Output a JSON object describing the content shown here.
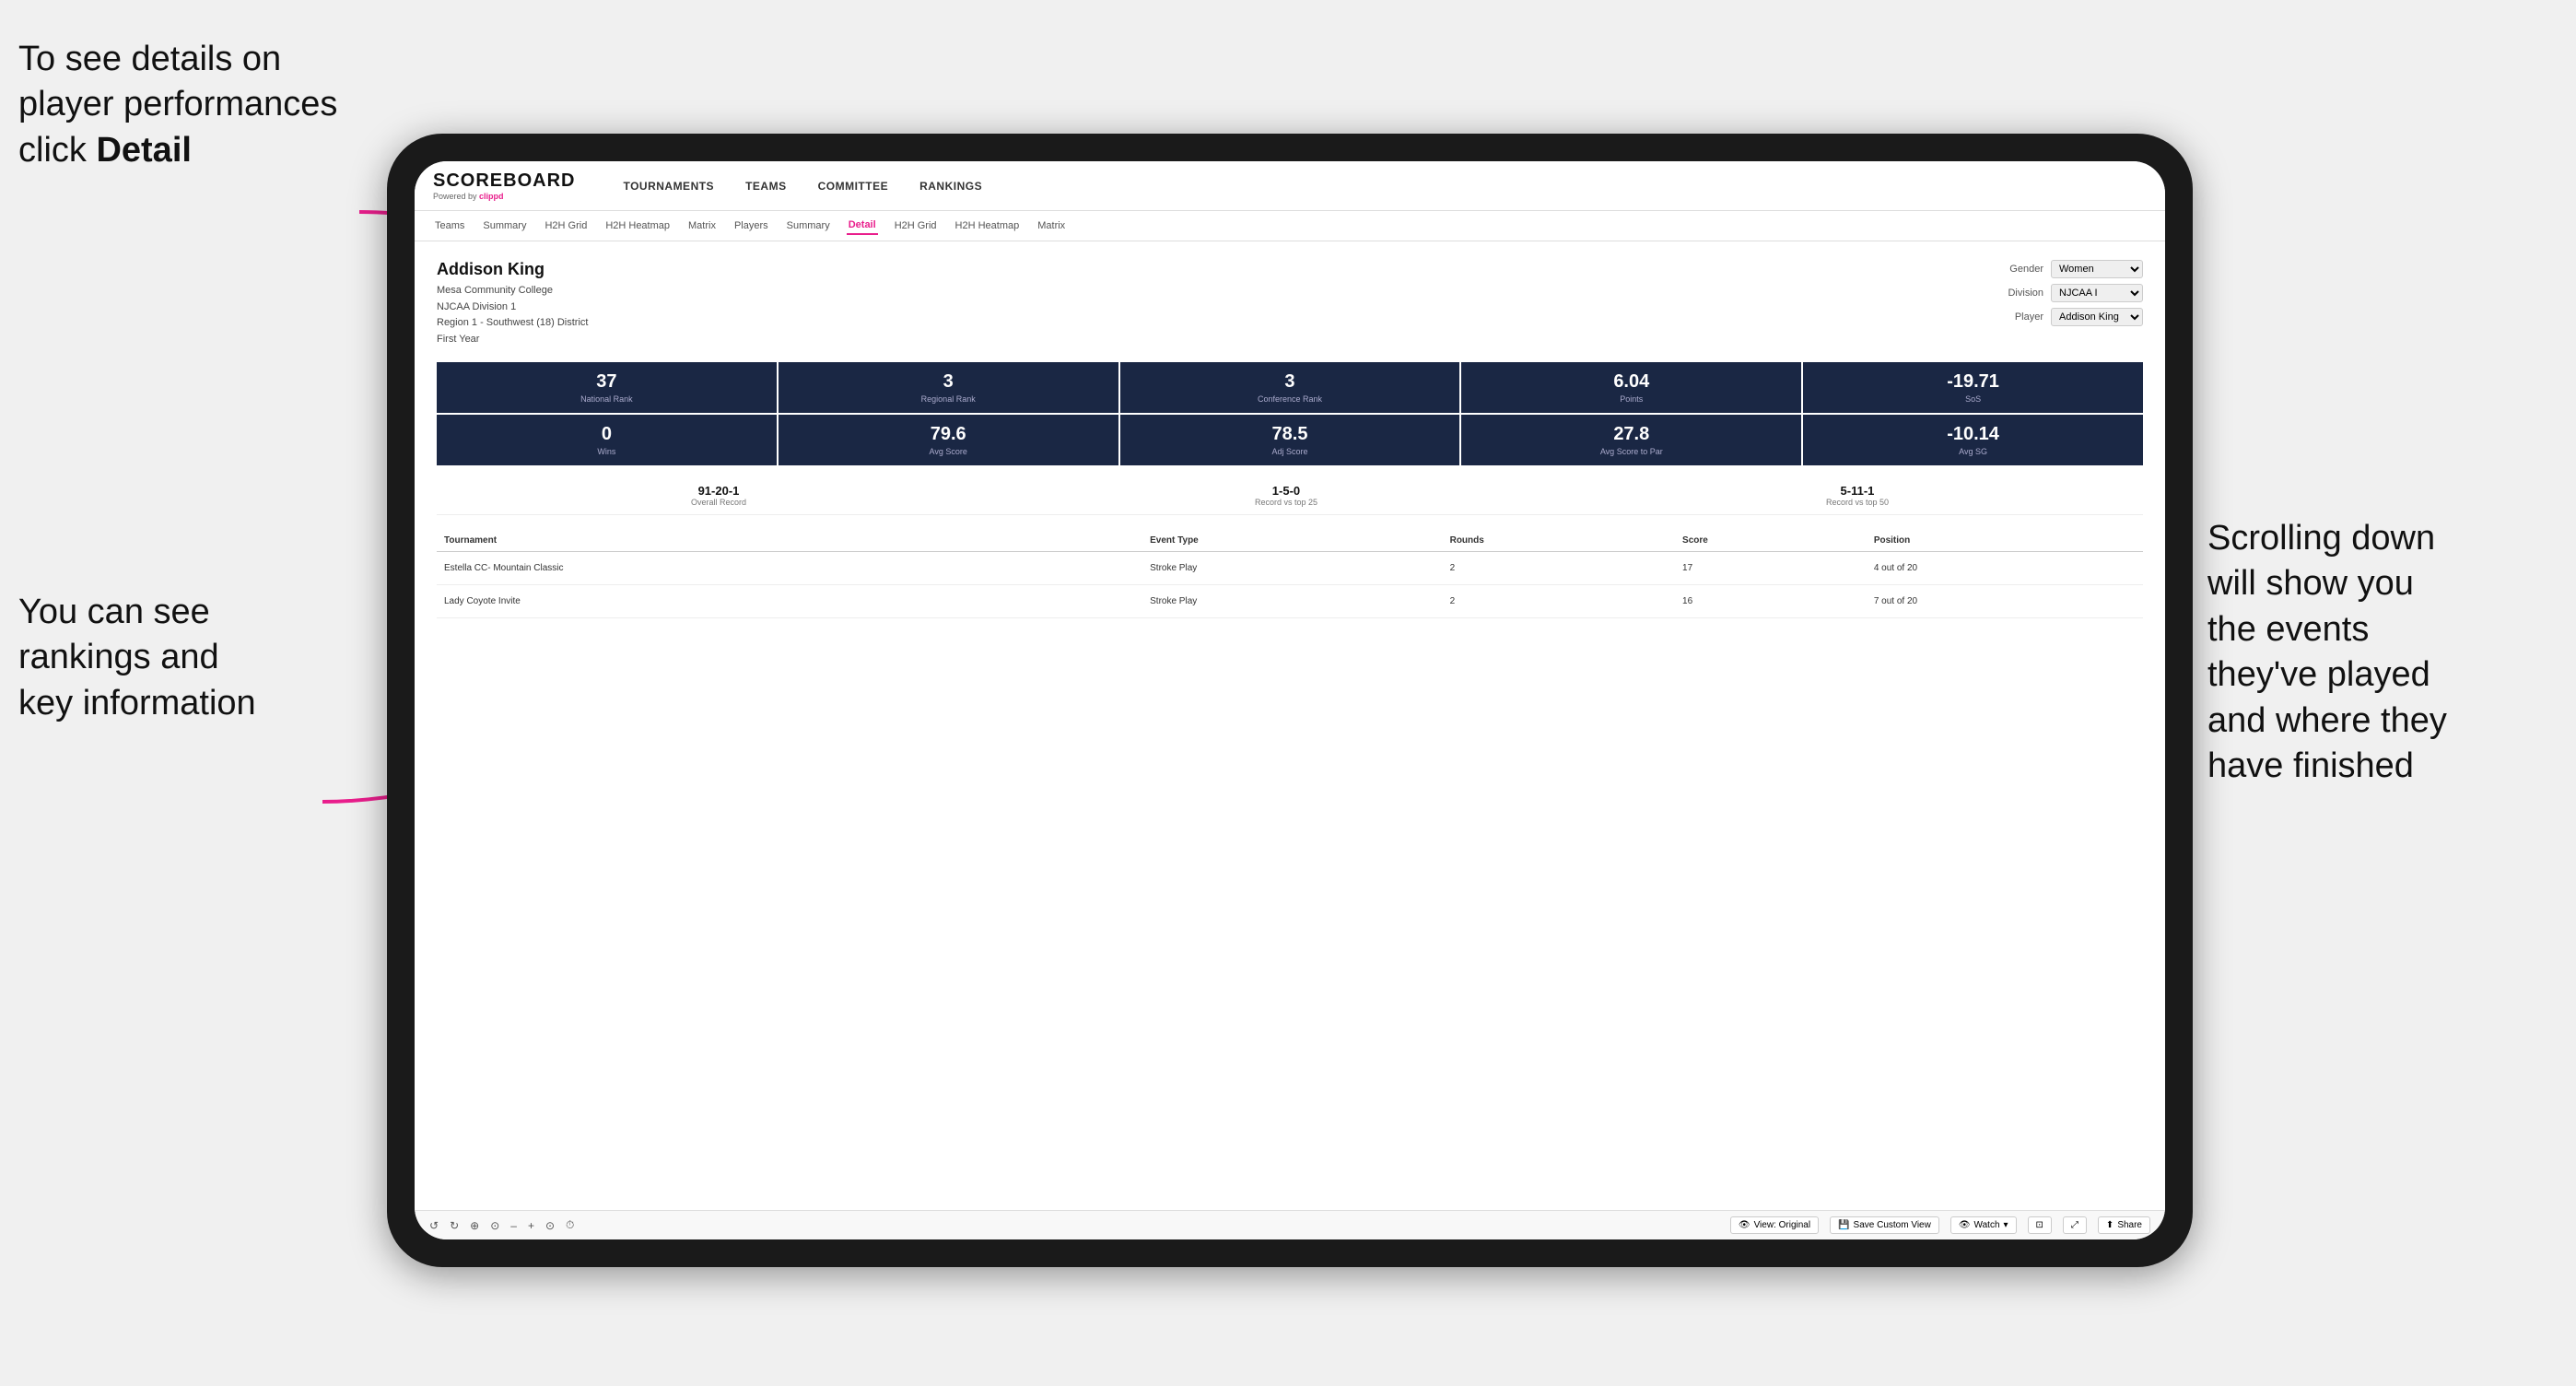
{
  "annotations": {
    "topleft": {
      "line1": "To see details on",
      "line2": "player performances",
      "line3_pre": "click ",
      "line3_bold": "Detail"
    },
    "bottomleft": {
      "line1": "You can see",
      "line2": "rankings and",
      "line3": "key information"
    },
    "bottomright": {
      "line1": "Scrolling down",
      "line2": "will show you",
      "line3": "the events",
      "line4": "they've played",
      "line5": "and where they",
      "line6": "have finished"
    }
  },
  "navbar": {
    "logo": "SCOREBOARD",
    "powered_by": "Powered by clippd",
    "items": [
      "TOURNAMENTS",
      "TEAMS",
      "COMMITTEE",
      "RANKINGS"
    ]
  },
  "subnav": {
    "items": [
      "Teams",
      "Summary",
      "H2H Grid",
      "H2H Heatmap",
      "Matrix",
      "Players",
      "Summary",
      "Detail",
      "H2H Grid",
      "H2H Heatmap",
      "Matrix"
    ]
  },
  "player": {
    "name": "Addison King",
    "school": "Mesa Community College",
    "division": "NJCAA Division 1",
    "region": "Region 1 - Southwest (18) District",
    "year": "First Year"
  },
  "filters": {
    "gender_label": "Gender",
    "gender_value": "Women",
    "division_label": "Division",
    "division_value": "NJCAA I",
    "player_label": "Player",
    "player_value": "Addison King"
  },
  "stats_row1": [
    {
      "value": "37",
      "label": "National Rank"
    },
    {
      "value": "3",
      "label": "Regional Rank"
    },
    {
      "value": "3",
      "label": "Conference Rank"
    },
    {
      "value": "6.04",
      "label": "Points"
    },
    {
      "value": "-19.71",
      "label": "SoS"
    }
  ],
  "stats_row2": [
    {
      "value": "0",
      "label": "Wins"
    },
    {
      "value": "79.6",
      "label": "Avg Score"
    },
    {
      "value": "78.5",
      "label": "Adj Score"
    },
    {
      "value": "27.8",
      "label": "Avg Score to Par"
    },
    {
      "value": "-10.14",
      "label": "Avg SG"
    }
  ],
  "records": [
    {
      "value": "91-20-1",
      "label": "Overall Record"
    },
    {
      "value": "1-5-0",
      "label": "Record vs top 25"
    },
    {
      "value": "5-11-1",
      "label": "Record vs top 50"
    }
  ],
  "table": {
    "headers": [
      "Tournament",
      "",
      "Event Type",
      "Rounds",
      "Score",
      "Position"
    ],
    "rows": [
      {
        "tournament": "Estella CC- Mountain Classic",
        "event_type": "Stroke Play",
        "rounds": "2",
        "score": "17",
        "position": "4 out of 20"
      },
      {
        "tournament": "Lady Coyote Invite",
        "event_type": "Stroke Play",
        "rounds": "2",
        "score": "16",
        "position": "7 out of 20"
      }
    ]
  },
  "toolbar": {
    "icons": [
      "↺",
      "↻",
      "⊕",
      "⊙",
      "–",
      "+",
      "⊙",
      "⏱"
    ],
    "view_original": "View: Original",
    "save_custom": "Save Custom View",
    "watch": "Watch",
    "share": "Share"
  }
}
